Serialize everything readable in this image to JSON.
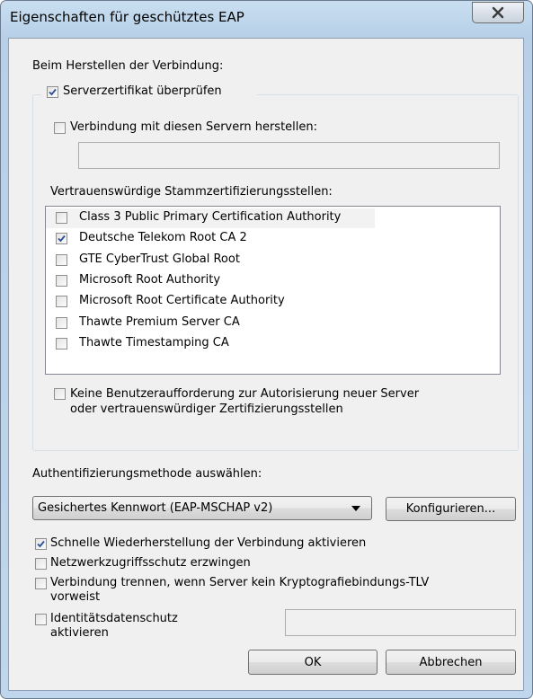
{
  "window": {
    "title": "Eigenschaften für geschütztes EAP"
  },
  "connection": {
    "heading": "Beim Herstellen der Verbindung:",
    "verify_cert": {
      "label": "Serverzertifikat überprüfen",
      "checked": true
    },
    "connect_servers": {
      "label": "Verbindung mit diesen Servern herstellen:",
      "checked": false
    },
    "servers_value": "",
    "trusted_heading": "Vertrauenswürdige Stammzertifizierungsstellen:",
    "authorities": [
      {
        "label": "Class 3 Public Primary Certification Authority",
        "checked": false
      },
      {
        "label": "Deutsche Telekom Root CA 2",
        "checked": true
      },
      {
        "label": "GTE CyberTrust Global Root",
        "checked": false
      },
      {
        "label": "Microsoft Root Authority",
        "checked": false
      },
      {
        "label": "Microsoft Root Certificate Authority",
        "checked": false
      },
      {
        "label": "Thawte Premium Server CA",
        "checked": false
      },
      {
        "label": "Thawte Timestamping CA",
        "checked": false
      }
    ],
    "no_prompt": {
      "line1": "Keine Benutzeraufforderung zur Autorisierung neuer Server",
      "line2": "oder vertrauenswürdiger Zertifizierungsstellen",
      "checked": false
    }
  },
  "auth": {
    "heading": "Authentifizierungsmethode auswählen:",
    "method": "Gesichertes Kennwort (EAP-MSCHAP v2)",
    "configure_label": "Konfigurieren..."
  },
  "options": {
    "fast_reconnect": {
      "label": "Schnelle Wiederherstellung der Verbindung aktivieren",
      "checked": true
    },
    "nap": {
      "label": "Netzwerkzugriffsschutz erzwingen",
      "checked": false
    },
    "disconnect": {
      "line1": "Verbindung trennen, wenn Server kein Kryptografiebindungs-TLV",
      "line2": "vorweist",
      "checked": false
    },
    "identity": {
      "line1": "Identitätsdatenschutz",
      "line2": "aktivieren",
      "checked": false,
      "value": ""
    }
  },
  "buttons": {
    "ok": "OK",
    "cancel": "Abbrechen"
  }
}
